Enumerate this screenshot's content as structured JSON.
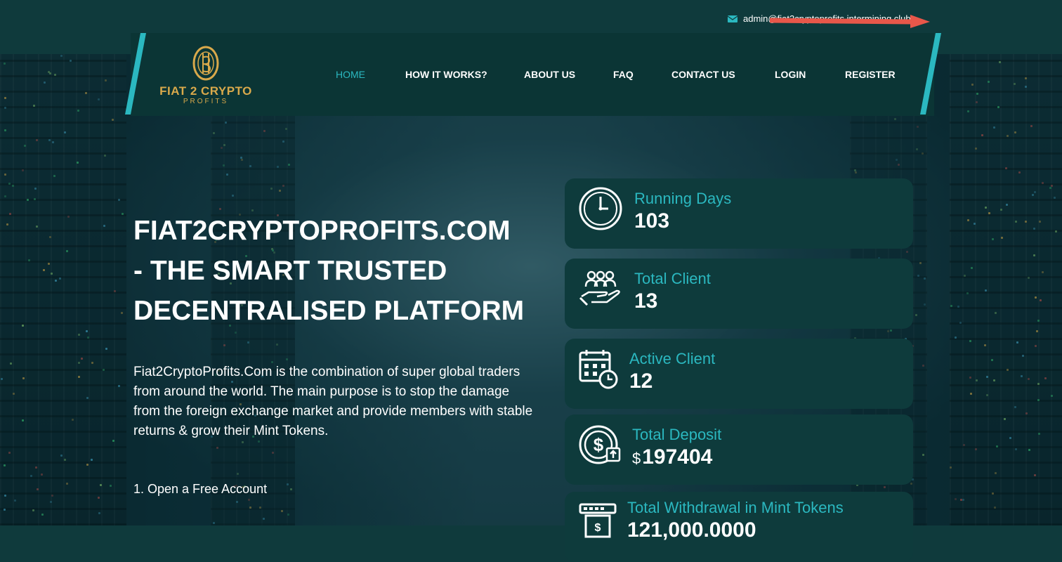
{
  "topbar": {
    "email": "admin@fiat2cryptoprofits.intermining.club"
  },
  "logo": {
    "name": "FIAT 2 CRYPTO",
    "sub": "PROFITS"
  },
  "nav": {
    "items": [
      {
        "label": "HOME",
        "active": true
      },
      {
        "label": "HOW IT WORKS?"
      },
      {
        "label": "ABOUT US"
      },
      {
        "label": "FAQ"
      },
      {
        "label": "CONTACT US"
      },
      {
        "label": "LOGIN"
      },
      {
        "label": "REGISTER"
      }
    ]
  },
  "hero": {
    "title_line1": "FIAT2CRYPTOPROFITS.COM",
    "title_line2": "- THE SMART TRUSTED",
    "title_line3": "DECENTRALISED PLATFORM",
    "description": "Fiat2CryptoProfits.Com is the combination of super global traders from around the world. The main purpose is to stop the damage from the foreign exchange market and provide members with stable returns & grow their Mint Tokens.",
    "step1": "1. Open a Free Account"
  },
  "stats": [
    {
      "label": "Running Days",
      "value": "103",
      "icon": "clock-icon"
    },
    {
      "label": "Total Client",
      "value": "13",
      "icon": "clients-hand-icon"
    },
    {
      "label": "Active Client",
      "value": "12",
      "icon": "calendar-clock-icon"
    },
    {
      "label": "Total Deposit",
      "currency": "$",
      "value": "197404",
      "icon": "dollar-coin-icon"
    },
    {
      "label": "Total Withdrawal in Mint Tokens",
      "value": "121,000.0000",
      "icon": "atm-withdraw-icon"
    }
  ],
  "colors": {
    "accent": "#2bb8c0",
    "gold": "#d9a94b",
    "nav_bg": "#0b3535",
    "card_bg": "#0e3b3c"
  }
}
